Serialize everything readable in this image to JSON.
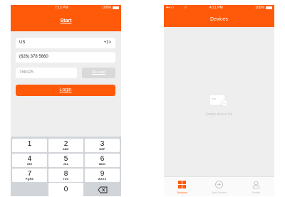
{
  "login_screen": {
    "status": {
      "time": "7:12 PM",
      "battery": "100%"
    },
    "title": "Start",
    "country": {
      "name": "US",
      "code": "+1>"
    },
    "phone": {
      "value": "(626) 378 5660"
    },
    "code": {
      "value": "768425"
    },
    "resend_label": "Re-send",
    "login_label": "Login",
    "keys": [
      {
        "digit": "1",
        "letters": ""
      },
      {
        "digit": "2",
        "letters": "ABC"
      },
      {
        "digit": "3",
        "letters": "DEF"
      },
      {
        "digit": "4",
        "letters": "GHI"
      },
      {
        "digit": "5",
        "letters": "JKL"
      },
      {
        "digit": "6",
        "letters": "MNO"
      },
      {
        "digit": "7",
        "letters": "PQRS"
      },
      {
        "digit": "8",
        "letters": "TUV"
      },
      {
        "digit": "9",
        "letters": "WXYZ"
      },
      {
        "digit": "0",
        "letters": ""
      }
    ],
    "delete_icon": "backspace-icon"
  },
  "devices_screen": {
    "status": {
      "carrier": "•••○○",
      "time": "4:21 PM",
      "battery": "100%"
    },
    "title": "Devices",
    "empty_text": "Empty device list",
    "tabs": [
      {
        "label": "Devices",
        "icon": "grid-icon",
        "active": true
      },
      {
        "label": "Add Device",
        "icon": "plus-circle-icon",
        "active": false
      },
      {
        "label": "Profile",
        "icon": "person-icon",
        "active": false
      }
    ]
  },
  "colors": {
    "accent": "#ff5a0a",
    "background": "#eeeeee"
  }
}
